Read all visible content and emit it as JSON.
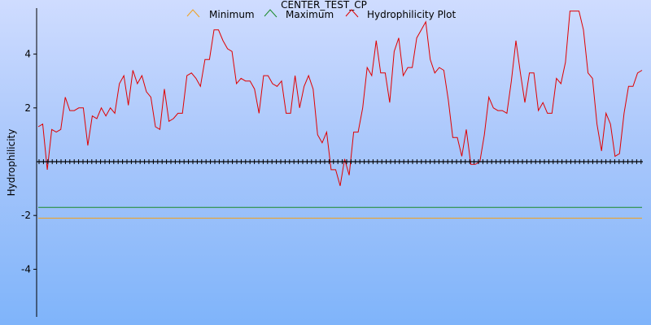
{
  "chart_data": {
    "type": "line",
    "title": "CENTER_TEST_CP",
    "ylabel": "Hydrophilicity",
    "xlabel": "",
    "ylim": [
      -5.8,
      5.7
    ],
    "y_ticks": [
      -4,
      -2,
      2,
      4
    ],
    "y_tick_labels": [
      "-4",
      "-2",
      "2",
      "4"
    ],
    "legend_position": "top-center",
    "series": [
      {
        "name": "Minimum",
        "color": "#f0a020",
        "icon": "line-marker-icon",
        "values": [
          -2.1,
          -2.1
        ]
      },
      {
        "name": "Maximum",
        "color": "#1a8a2a",
        "icon": "line-marker-icon",
        "values": [
          -1.7,
          -1.7
        ]
      },
      {
        "name": "Hydrophilicity Plot",
        "color": "#e00000",
        "icon": "line-marker-icon",
        "values": [
          1.3,
          1.4,
          -0.3,
          1.2,
          1.1,
          1.2,
          2.4,
          1.9,
          1.9,
          2.0,
          2.0,
          0.6,
          1.7,
          1.6,
          2.0,
          1.7,
          2.0,
          1.8,
          2.9,
          3.2,
          2.1,
          3.4,
          2.9,
          3.2,
          2.6,
          2.4,
          1.3,
          1.2,
          2.7,
          1.5,
          1.6,
          1.8,
          1.8,
          3.2,
          3.3,
          3.1,
          2.8,
          3.8,
          3.8,
          4.9,
          4.9,
          4.5,
          4.2,
          4.1,
          2.9,
          3.1,
          3.0,
          3.0,
          2.7,
          1.8,
          3.2,
          3.2,
          2.9,
          2.8,
          3.0,
          1.8,
          1.8,
          3.2,
          2.0,
          2.8,
          3.2,
          2.7,
          1.0,
          0.7,
          1.1,
          -0.3,
          -0.3,
          -0.9,
          0.1,
          -0.5,
          1.1,
          1.1,
          2.0,
          3.5,
          3.2,
          4.5,
          3.3,
          3.3,
          2.2,
          4.1,
          4.6,
          3.2,
          3.5,
          3.5,
          4.6,
          4.9,
          5.2,
          3.8,
          3.3,
          3.5,
          3.4,
          2.3,
          0.9,
          0.9,
          0.2,
          1.2,
          -0.1,
          -0.1,
          0.0,
          1.0,
          2.4,
          2.0,
          1.9,
          1.9,
          1.8,
          3.0,
          4.5,
          3.3,
          2.2,
          3.3,
          3.3,
          1.9,
          2.2,
          1.8,
          1.8,
          3.1,
          2.9,
          3.7,
          5.6,
          5.6,
          5.6,
          4.9,
          3.3,
          3.1,
          1.4,
          0.4,
          1.8,
          1.4,
          0.2,
          0.3,
          1.8,
          2.8,
          2.8,
          3.3,
          3.4
        ]
      }
    ]
  }
}
